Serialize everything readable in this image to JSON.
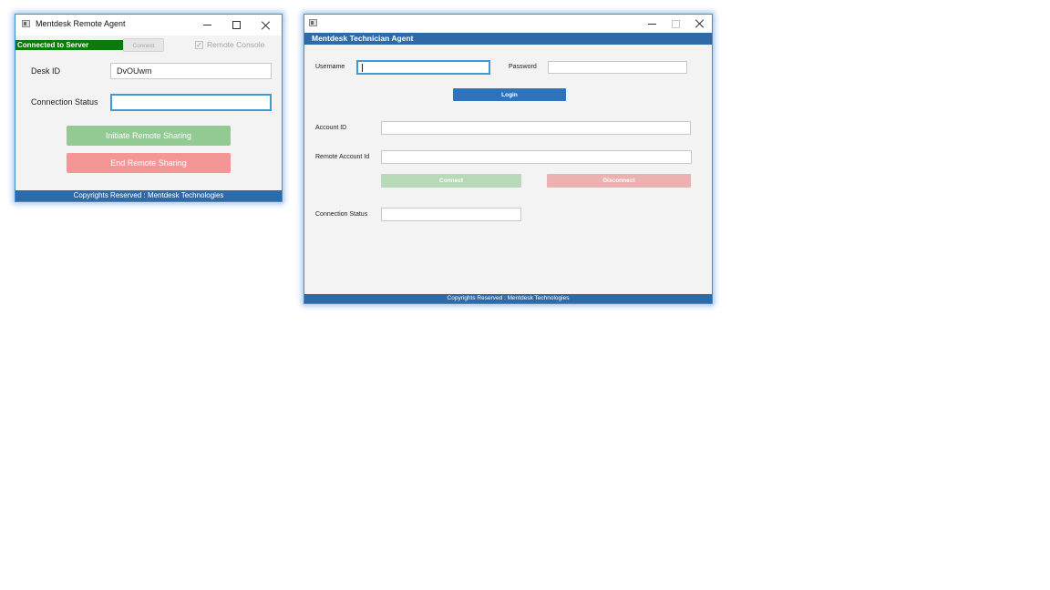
{
  "remote_agent": {
    "title": "Mentdesk Remote Agent",
    "status_text": "Connected to Server",
    "connect_label": "Connect",
    "remote_console_label": "Remote Console",
    "remote_console_checked": true,
    "desk_id_label": "Desk ID",
    "desk_id_value": "DvOUwm",
    "connection_status_label": "Connection Status",
    "connection_status_value": "",
    "initiate_label": "Initiate Remote Sharing",
    "end_label": "End Remote Sharing",
    "footer": "Copyrights Reserved : Mentdesk Technologies",
    "colors": {
      "status": "#0a7a0a",
      "initiate": "#93c993",
      "end": "#f59696",
      "footer": "#2f6aa8"
    }
  },
  "technician_agent": {
    "title": "",
    "header": "Mentdesk Technician Agent",
    "username_label": "Username",
    "username_value": "",
    "password_label": "Password",
    "password_value": "",
    "login_label": "Login",
    "account_id_label": "Account ID",
    "account_id_value": "",
    "remote_account_label": "Remote Account Id",
    "remote_account_value": "",
    "connect_label": "Connect",
    "disconnect_label": "Disconnect",
    "connection_status_label": "Connection Status",
    "connection_status_value": "",
    "footer": "Copyrights Reserved : Mentdesk Technologies",
    "colors": {
      "login": "#2f73ba",
      "connect": "#b8dab8",
      "disconnect": "#ecb2b2",
      "header": "#2f6aa8"
    }
  },
  "icons": [
    "app-icon",
    "minimize-icon",
    "maximize-icon",
    "close-icon",
    "checkmark-icon"
  ]
}
